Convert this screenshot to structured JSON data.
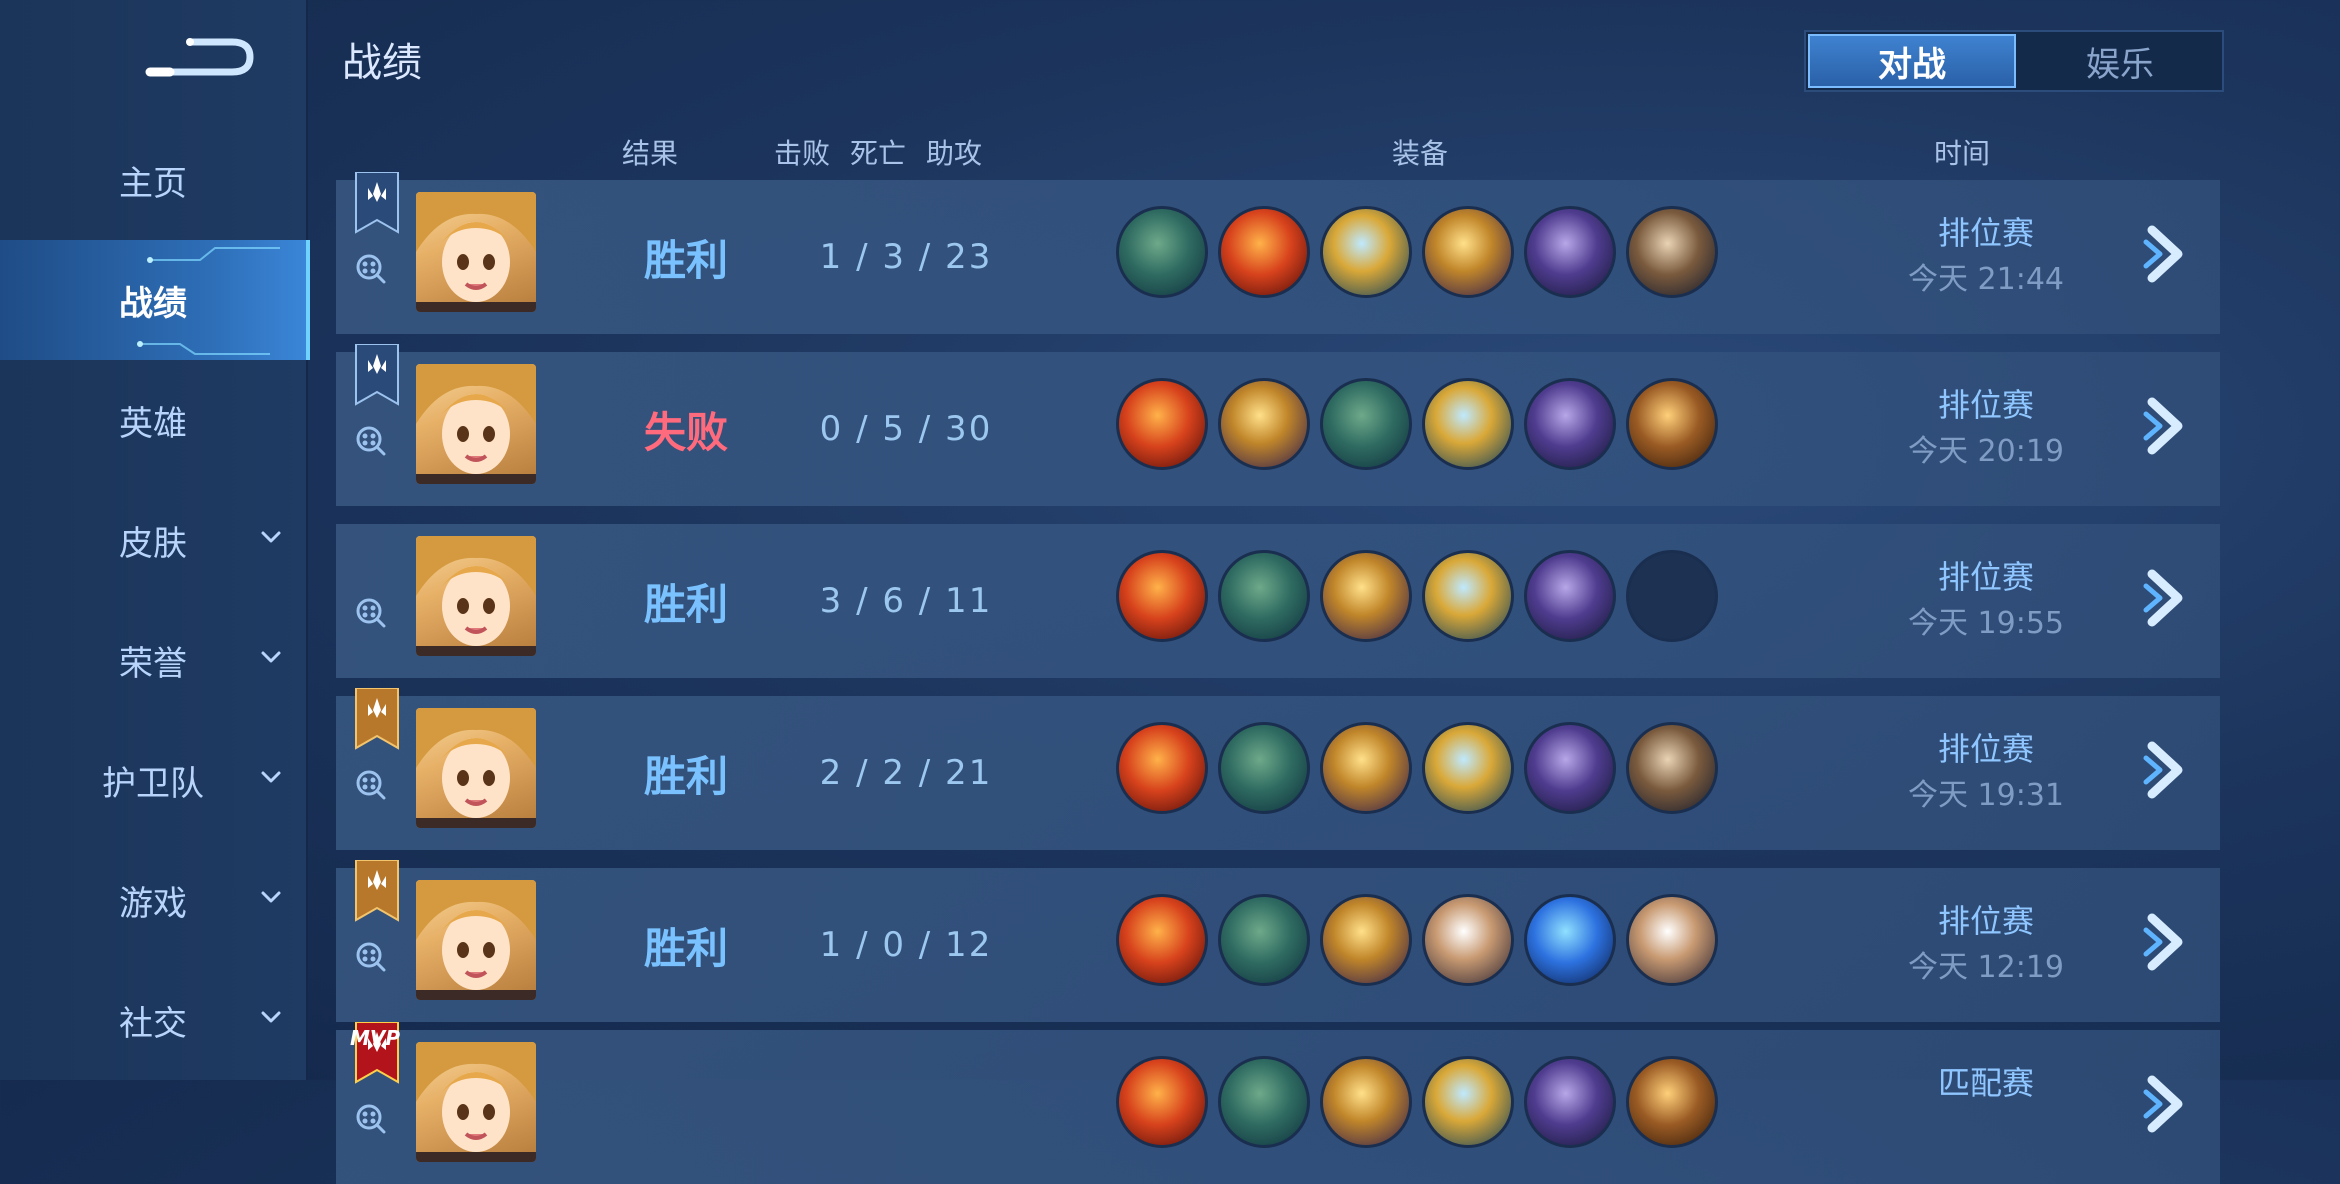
{
  "header": {
    "title": "战绩"
  },
  "tabs": [
    {
      "label": "对战",
      "active": true
    },
    {
      "label": "娱乐",
      "active": false
    }
  ],
  "sidebar": {
    "items": [
      {
        "label": "主页",
        "active": false,
        "has_dropdown": false
      },
      {
        "label": "战绩",
        "active": true,
        "has_dropdown": false
      },
      {
        "label": "英雄",
        "active": false,
        "has_dropdown": false
      },
      {
        "label": "皮肤",
        "active": false,
        "has_dropdown": true
      },
      {
        "label": "荣誉",
        "active": false,
        "has_dropdown": true
      },
      {
        "label": "护卫队",
        "active": false,
        "has_dropdown": true
      },
      {
        "label": "游戏",
        "active": false,
        "has_dropdown": true
      },
      {
        "label": "社交",
        "active": false,
        "has_dropdown": true
      }
    ]
  },
  "columns": {
    "result": "结果",
    "kills": "击败",
    "deaths": "死亡",
    "assists": "助攻",
    "equipment": "装备",
    "time": "时间"
  },
  "matches": [
    {
      "badge": "silver",
      "result": "胜利",
      "result_type": "win",
      "kda": "1 / 3 / 23",
      "items": [
        "boots",
        "flame-medallion",
        "gold-wing",
        "chalice",
        "purple-cloak",
        "armor-plate"
      ],
      "mode": "排位赛",
      "time": "今天 21:44"
    },
    {
      "badge": "silver",
      "result": "失败",
      "result_type": "loss",
      "kda": "0 / 5 / 30",
      "items": [
        "flame-medallion",
        "chalice",
        "boots",
        "gold-wing",
        "purple-cloak",
        "spiked-shield"
      ],
      "mode": "排位赛",
      "time": "今天 20:19"
    },
    {
      "badge": "none",
      "result": "胜利",
      "result_type": "win",
      "kda": "3 / 6 / 11",
      "items": [
        "flame-medallion",
        "boots",
        "chalice",
        "gold-wing",
        "purple-cloak",
        "empty"
      ],
      "mode": "排位赛",
      "time": "今天 19:55"
    },
    {
      "badge": "gold",
      "result": "胜利",
      "result_type": "win",
      "kda": "2 / 2 / 21",
      "items": [
        "flame-medallion",
        "boots",
        "chalice",
        "gold-wing",
        "purple-cloak",
        "armor-plate"
      ],
      "mode": "排位赛",
      "time": "今天 19:31"
    },
    {
      "badge": "gold",
      "result": "胜利",
      "result_type": "win",
      "kda": "1 / 0 / 12",
      "items": [
        "flame-medallion",
        "boots",
        "chalice",
        "robe-vest",
        "blue-crystal",
        "robe-vest"
      ],
      "mode": "排位赛",
      "time": "今天 12:19"
    },
    {
      "badge": "mvp",
      "badge_text": "MVP",
      "result": "",
      "result_type": "win",
      "kda": "",
      "items": [
        "flame-medallion",
        "boots",
        "chalice",
        "gold-wing",
        "purple-cloak",
        "spiked-shield"
      ],
      "mode": "匹配赛",
      "time": ""
    }
  ],
  "colors": {
    "accent": "#3f82d0",
    "win": "#79c2ff",
    "loss": "#ff6a7d",
    "row_bg": "#385882"
  }
}
